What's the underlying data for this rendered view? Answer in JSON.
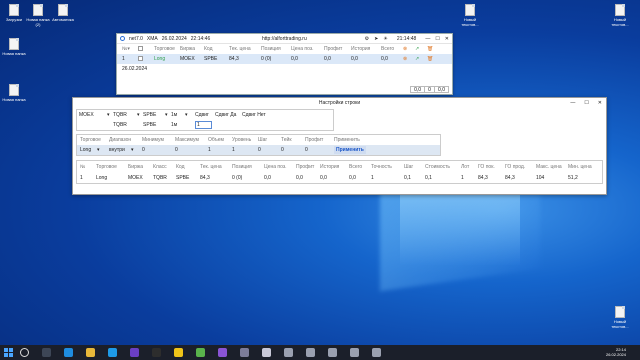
{
  "desktop": {
    "icons": [
      {
        "label": "Загрузки"
      },
      {
        "label": "Новая папка (2)"
      },
      {
        "label": "Автоматика"
      },
      {
        "label": "Новая папка"
      },
      {
        "label": "Новая папка"
      },
      {
        "label": "Новый текстов..."
      },
      {
        "label": "Новый текстов..."
      },
      {
        "label": "Новый текстов..."
      }
    ]
  },
  "window1": {
    "app": "net7.0",
    "symbol": "XMA",
    "date_title": "26.02.2024",
    "time_title": "22:14:46",
    "url": "http://alforttrading.ru",
    "clock": "21:14:48",
    "columns": [
      "№▾",
      "",
      "Торговое",
      "Биржа",
      "Код",
      "Тек. цена",
      "Позиция",
      "Цена поз.",
      "Профит",
      "История",
      "Всего"
    ],
    "row": {
      "num": "1",
      "trade": "Long",
      "exchange": "MOEX",
      "code": "SPBE",
      "price": "84,3",
      "position": "0",
      "position_paren": "(0)",
      "pos_price": "0,0",
      "profit": "0,0",
      "history": "0,0",
      "total": "0,0"
    },
    "date_row": "26.02.2024",
    "footer": [
      "0,0",
      "0",
      "0,0"
    ]
  },
  "window2": {
    "title": "Настройки строки",
    "block1": {
      "exchange": "MOEX",
      "board": "TQBR",
      "code1": "SPBE",
      "interval": "1м",
      "shift_label": "Сдвиг",
      "shift_yes_label": "Сдвиг Да",
      "shift_no_label": "Сдвиг Нет",
      "board2": "TQBR",
      "code2": "SPBE",
      "interval2": "1м",
      "shift_value": "1"
    },
    "block2": {
      "headers": [
        "Торговое",
        "Диапазон",
        "Минимум",
        "Максимум",
        "Объем",
        "Уровень",
        "Шаг",
        "Тейк",
        "Профит",
        "Применить"
      ],
      "values": [
        "Long",
        "внутри",
        "0",
        "0",
        "1",
        "1",
        "0",
        "0",
        "0",
        "Применить"
      ]
    },
    "block3": {
      "headers": [
        "№",
        "Торговое",
        "Биржа",
        "Класс",
        "Код",
        "Тек. цена",
        "Позиция",
        "Цена поз.",
        "Профит",
        "История",
        "Всего",
        "Точность",
        "Шаг",
        "Стоимость",
        "Лот",
        "ГО пок.",
        "ГО прод.",
        "Макс. цена",
        "Мин. цена"
      ],
      "values": [
        "1",
        "Long",
        "MOEX",
        "TQBR",
        "SPBE",
        "84,3",
        "0",
        "(0)",
        "0,0",
        "0,0",
        "0,0",
        "0,0",
        "1",
        "0,1",
        "0,1",
        "1",
        "84,3",
        "84,3",
        "104",
        "51,2"
      ]
    }
  },
  "taskbar": {
    "time": "22:14",
    "date": "26.02.2024"
  }
}
